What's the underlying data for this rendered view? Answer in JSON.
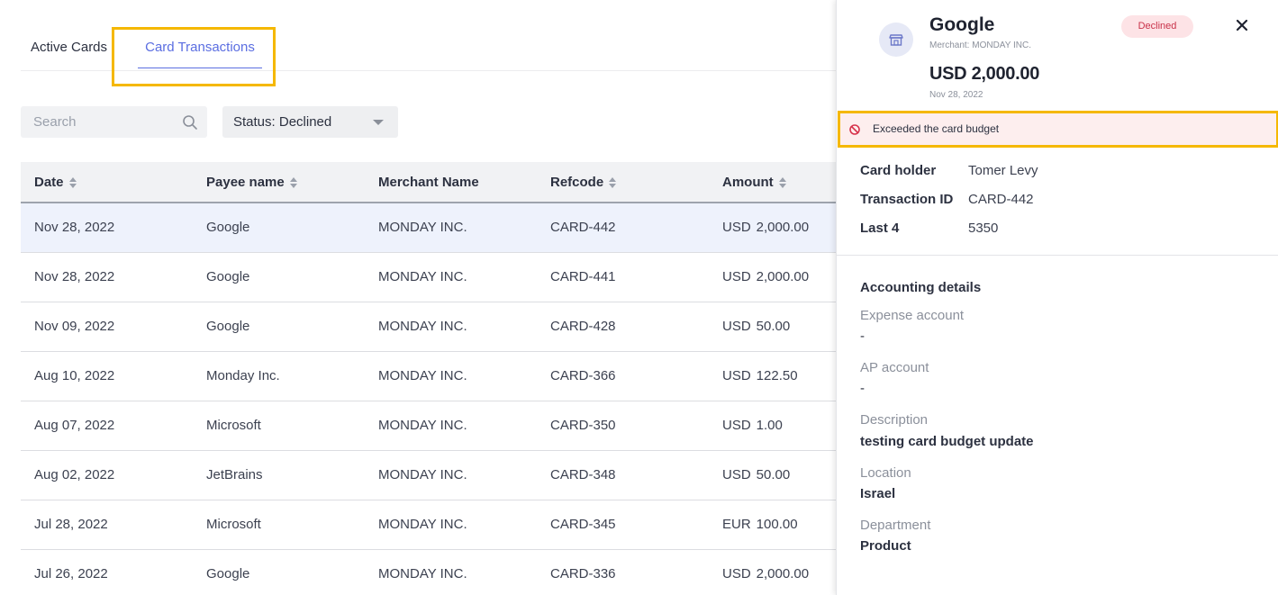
{
  "tabs": [
    {
      "label": "Active Cards",
      "active": false
    },
    {
      "label": "Card Transactions",
      "active": true
    }
  ],
  "filters": {
    "search_placeholder": "Search",
    "status_label": "Status: Declined"
  },
  "table": {
    "columns": [
      "Date",
      "Payee name",
      "Merchant Name",
      "Refcode",
      "Amount"
    ],
    "rows": [
      {
        "date": "Nov 28, 2022",
        "payee": "Google",
        "merchant": "MONDAY INC.",
        "refcode": "CARD-442",
        "currency": "USD",
        "amount": "2,000.00",
        "selected": true
      },
      {
        "date": "Nov 28, 2022",
        "payee": "Google",
        "merchant": "MONDAY INC.",
        "refcode": "CARD-441",
        "currency": "USD",
        "amount": "2,000.00"
      },
      {
        "date": "Nov 09, 2022",
        "payee": "Google",
        "merchant": "MONDAY INC.",
        "refcode": "CARD-428",
        "currency": "USD",
        "amount": "50.00"
      },
      {
        "date": "Aug 10, 2022",
        "payee": "Monday Inc.",
        "merchant": "MONDAY INC.",
        "refcode": "CARD-366",
        "currency": "USD",
        "amount": "122.50"
      },
      {
        "date": "Aug 07, 2022",
        "payee": "Microsoft",
        "merchant": "MONDAY INC.",
        "refcode": "CARD-350",
        "currency": "USD",
        "amount": "1.00"
      },
      {
        "date": "Aug 02, 2022",
        "payee": "JetBrains",
        "merchant": "MONDAY INC.",
        "refcode": "CARD-348",
        "currency": "USD",
        "amount": "50.00"
      },
      {
        "date": "Jul 28, 2022",
        "payee": "Microsoft",
        "merchant": "MONDAY INC.",
        "refcode": "CARD-345",
        "currency": "EUR",
        "amount": "100.00"
      },
      {
        "date": "Jul 26, 2022",
        "payee": "Google",
        "merchant": "MONDAY INC.",
        "refcode": "CARD-336",
        "currency": "USD",
        "amount": "2,000.00"
      }
    ]
  },
  "detail": {
    "icon": "store-icon",
    "title": "Google",
    "merchant": "Merchant: MONDAY INC.",
    "amount": "USD 2,000.00",
    "date": "Nov 28, 2022",
    "status": "Declined",
    "alert": "Exceeded the card budget",
    "card_holder_label": "Card holder",
    "card_holder": "Tomer Levy",
    "transaction_id_label": "Transaction ID",
    "transaction_id": "CARD-442",
    "last4_label": "Last 4",
    "last4": "5350",
    "accounting_title": "Accounting details",
    "expense_account_label": "Expense account",
    "expense_account": "-",
    "ap_account_label": "AP account",
    "ap_account": "-",
    "description_label": "Description",
    "description": "testing card budget update",
    "location_label": "Location",
    "location": "Israel",
    "department_label": "Department",
    "department": "Product"
  },
  "colors": {
    "accent": "#5b6ee1",
    "highlight": "#f5b800",
    "declined": "#c9324a"
  }
}
